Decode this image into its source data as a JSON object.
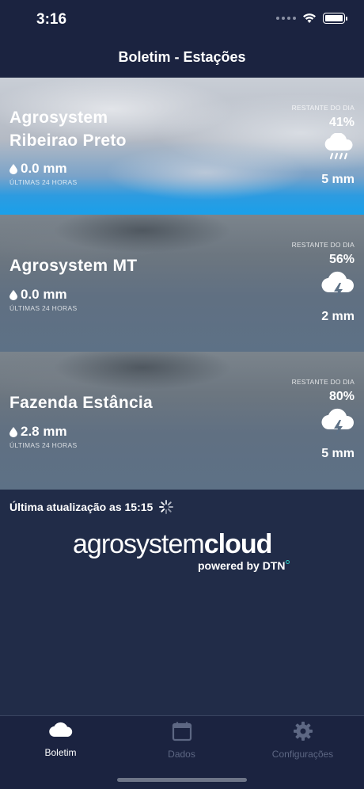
{
  "status_bar": {
    "time": "3:16"
  },
  "nav": {
    "title": "Boletim - Estações"
  },
  "stations": [
    {
      "name_line1": "Agrosystem",
      "name_line2": "Ribeirao Preto",
      "rain": "0.0 mm",
      "rain_caption": "ÚLTIMAS 24 HORAS",
      "remaining_label": "RESTANTE DO DIA",
      "percent": "41%",
      "forecast": "5 mm",
      "icon": "cloud-rain-icon"
    },
    {
      "name_line1": "Agrosystem MT",
      "rain": "0.0 mm",
      "rain_caption": "ÚLTIMAS 24 HORAS",
      "remaining_label": "RESTANTE DO DIA",
      "percent": "56%",
      "forecast": "2 mm",
      "icon": "cloud-lightning-icon"
    },
    {
      "name_line1": "Fazenda Estância",
      "rain": "2.8 mm",
      "rain_caption": "ÚLTIMAS 24 HORAS",
      "remaining_label": "RESTANTE DO DIA",
      "percent": "80%",
      "forecast": "5 mm",
      "icon": "cloud-lightning-icon"
    }
  ],
  "update": {
    "text": "Última atualização as 15:15"
  },
  "logo": {
    "part1": "agrosystem",
    "part2": "cloud",
    "powered": "powered by",
    "brand": "DTN"
  },
  "tabs": [
    {
      "label": "Boletim",
      "icon": "cloud-icon",
      "active": true
    },
    {
      "label": "Dados",
      "icon": "calendar-icon",
      "active": false
    },
    {
      "label": "Configurações",
      "icon": "gear-icon",
      "active": false
    }
  ],
  "colors": {
    "background": "#212c48",
    "bar": "#1b2340",
    "accent_teal": "#2fd0c8",
    "inactive_tab": "#5d6783"
  }
}
